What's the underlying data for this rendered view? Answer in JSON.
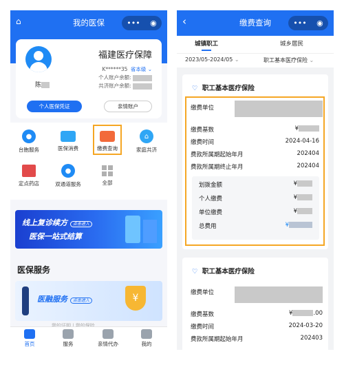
{
  "left": {
    "header_title": "我的医保",
    "insurer_name": "福建医疗保障",
    "account_id": "K******35",
    "level_label": "省本级",
    "user_name_prefix": "陈",
    "balance_personal_label": "个人账户余额:",
    "balance_shared_label": "共济账户余额:",
    "btn_voucher": "个人医保凭证",
    "btn_family": "亲情账户",
    "grid": [
      {
        "label": "台胞服务",
        "icon": "taiwan-service-icon"
      },
      {
        "label": "医保消费",
        "icon": "card-icon"
      },
      {
        "label": "缴费查询",
        "icon": "wallet-icon"
      },
      {
        "label": "家庭共济",
        "icon": "home-icon"
      },
      {
        "label": "定点药店",
        "icon": "pharmacy-icon"
      },
      {
        "label": "双通道服务",
        "icon": "dual-channel-icon"
      },
      {
        "label": "全部",
        "icon": "grid-icon"
      }
    ],
    "banner1_line1": "线上复诊续方",
    "banner1_tag": "点击进入",
    "banner1_line2": "医保一站式结算",
    "section_title": "医保服务",
    "banner2_title": "医融服务",
    "banner2_tag": "点击进入",
    "banner2_sub1": "我的证明",
    "banner2_sub2": "我的保险",
    "tabs": [
      {
        "label": "首页",
        "icon": "home-tab-icon",
        "active": true
      },
      {
        "label": "服务",
        "icon": "service-tab-icon",
        "active": false
      },
      {
        "label": "亲情代办",
        "icon": "family-tab-icon",
        "active": false
      },
      {
        "label": "我的",
        "icon": "profile-tab-icon",
        "active": false
      }
    ]
  },
  "right": {
    "header_title": "缴费查询",
    "tab_urban_employee": "城镇职工",
    "tab_urban_resident": "城乡居民",
    "filter_period": "2023/05-2024/05",
    "filter_type": "职工基本医疗保险",
    "card1": {
      "title": "职工基本医疗保险",
      "unit_label": "缴费单位",
      "base_label": "缴费基数",
      "base_prefix": "¥",
      "time_label": "缴费时间",
      "time_value": "2024-04-16",
      "start_label": "费款所属期起始年月",
      "start_value": "202404",
      "end_label": "费款所属期终止年月",
      "end_value": "202404",
      "transfer_label": "划拨金额",
      "personal_label": "个人缴费",
      "company_label": "单位缴费",
      "total_label": "总费用",
      "currency": "¥"
    },
    "card2": {
      "title": "职工基本医疗保险",
      "unit_label": "缴费单位",
      "base_label": "缴费基数",
      "base_suffix": ".00",
      "time_label": "缴费时间",
      "time_value": "2024-03-20",
      "start_label": "费款所属期起始年月",
      "start_value": "202403",
      "currency": "¥"
    }
  },
  "colors": {
    "primary": "#1f70f2",
    "highlight": "#f5a623",
    "total_blue": "#1f8bf5"
  }
}
